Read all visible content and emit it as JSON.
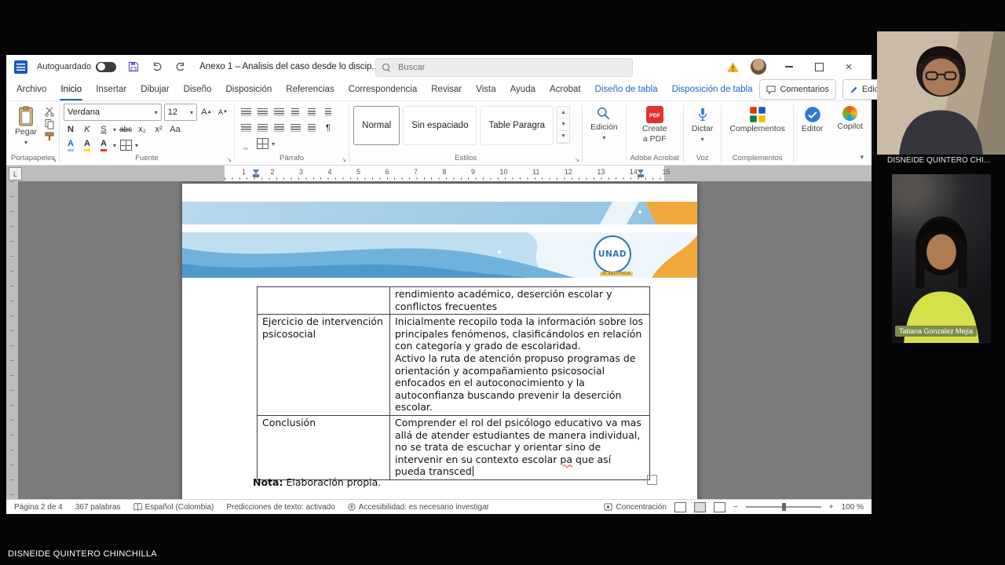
{
  "window": {
    "titlebar": {
      "autosave": "Autoguardado",
      "title": "Anexo 1 – Analisis del caso desde lo discip...",
      "search_placeholder": "Buscar"
    },
    "tabs": [
      {
        "label": "Archivo"
      },
      {
        "label": "Inicio"
      },
      {
        "label": "Insertar"
      },
      {
        "label": "Dibujar"
      },
      {
        "label": "Diseño"
      },
      {
        "label": "Disposición"
      },
      {
        "label": "Referencias"
      },
      {
        "label": "Correspondencia"
      },
      {
        "label": "Revisar"
      },
      {
        "label": "Vista"
      },
      {
        "label": "Ayuda"
      },
      {
        "label": "Acrobat"
      },
      {
        "label": "Diseño de tabla"
      },
      {
        "label": "Disposición de tabla"
      }
    ],
    "tab_actions": {
      "comments": "Comentarios",
      "editing_mode": "Edición"
    },
    "ribbon": {
      "paste": "Pegar",
      "clipboard_group": "Portapapeles",
      "font_name": "Verdana",
      "font_size": "12",
      "bold": "N",
      "italic": "K",
      "underline": "S",
      "strike": "abc",
      "subscript": "x₂",
      "superscript": "x²",
      "change_case": "Aa",
      "grow_font": "A",
      "shrink_font": "A",
      "text_effects": "A",
      "highlight": "A",
      "font_color": "A",
      "font_group": "Fuente",
      "paragraph_mark": "¶",
      "paragraph_group": "Párrafo",
      "styles": [
        {
          "name": "Normal"
        },
        {
          "name": "Sin espaciado"
        },
        {
          "name": "Table Paragra"
        }
      ],
      "styles_group": "Estilos",
      "editing": "Edición",
      "create_pdf_1": "Create",
      "create_pdf_2": "a PDF",
      "adobe_group": "Adobe Acrobat",
      "dictate": "Dictar",
      "voice_group": "Voz",
      "addins": "Complementos",
      "addins_group": "Complementos",
      "editor": "Editor",
      "copilot": "Copilot"
    },
    "ruler": {
      "tab_selector": "L",
      "numbers": "1 2 3 4 5 6 7 8 9 10 11 12 13 14 15"
    },
    "statusbar": {
      "page": "Página 2 de 4",
      "words": "367 palabras",
      "language": "Español (Colombia)",
      "predictions": "Predicciones de texto: activado",
      "accessibility": "Accesibilidad: es necesario investigar",
      "focus": "Concentración",
      "zoom": "100 %"
    }
  },
  "document": {
    "logo": {
      "name": "UNAD",
      "accredited": "ACREDITADA"
    },
    "table": {
      "row1": {
        "col2": "rendimiento académico, deserción escolar y conflictos frecuentes"
      },
      "row2": {
        "col1": "Ejercicio de intervención psicosocial",
        "col2_p1": "Inicialmente recopilo toda la información sobre los principales fenómenos, clasificándolos en relación con categoría y grado de escolaridad.",
        "col2_p2": "Activo la ruta de atención propuso programas de orientación y acompañamiento psicosocial enfocados en el autoconocimiento y la autoconfianza buscando prevenir la deserción escolar."
      },
      "row3": {
        "col1": "Conclusión",
        "col2_before": "Comprender el rol del psicólogo educativo va mas allá de atender estudiantes de manera individual, no se trata de escuchar y orientar sino de intervenir en su contexto escolar ",
        "col2_misspelled": "pa",
        "col2_after": " que así pueda transced"
      }
    },
    "note_bold": "Nota:",
    "note_text": " Elaboración propia."
  },
  "meeting": {
    "participant_top": "DISNEIDE QUINTERO CHI...",
    "participant_bottom_badge": "Tatiana Gonzalez Mejía",
    "presenter_name": "DISNEIDE QUINTERO CHINCHILLA"
  },
  "colors": {
    "accent_blue": "#1a66c2",
    "word_blue": "#185abd",
    "header_blue": "#6fb3dd",
    "header_orange": "#f2a93b",
    "badge_green": "#7d8c49",
    "spell_red": "#e03c31"
  }
}
